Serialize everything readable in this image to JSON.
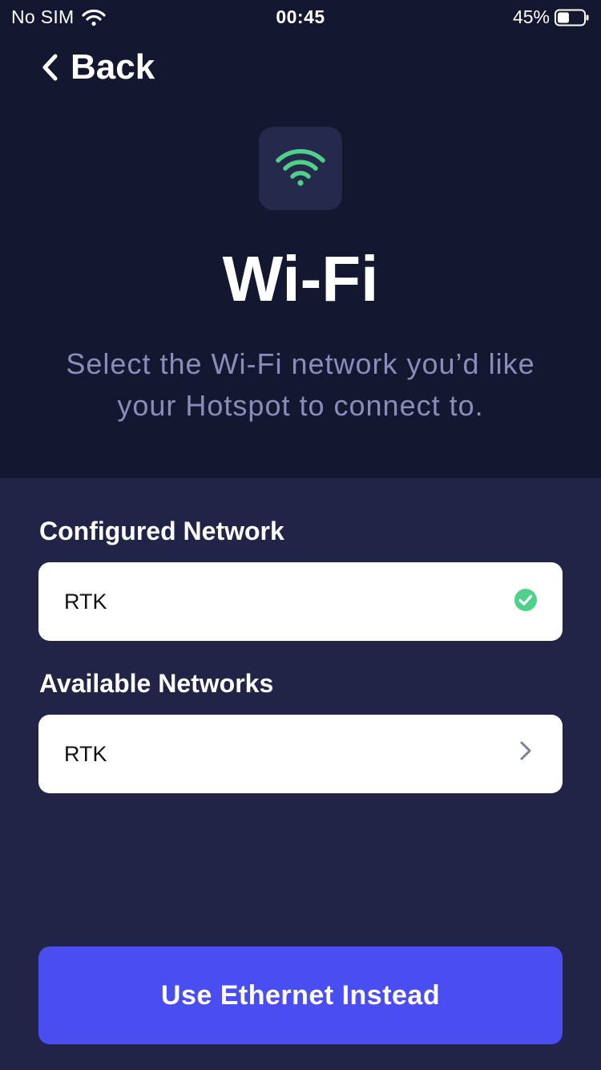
{
  "status_bar": {
    "carrier": "No SIM",
    "time": "00:45",
    "battery_percent": "45%",
    "battery_level": 0.45,
    "icons": [
      "wifi-signal-icon",
      "battery-icon"
    ]
  },
  "nav": {
    "back_label": "Back",
    "back_icon": "chevron-left-icon"
  },
  "header": {
    "icon": "wifi-icon",
    "icon_color": "#4fd18b",
    "title": "Wi-Fi",
    "subtitle": "Select the Wi-Fi network you’d like your Hotspot to connect to."
  },
  "configured": {
    "heading": "Configured Network",
    "network": {
      "name": "RTK",
      "icon": "check-circle-icon",
      "icon_color": "#4fd18b"
    }
  },
  "available": {
    "heading": "Available Networks",
    "networks": [
      {
        "name": "RTK",
        "icon": "chevron-right-icon"
      }
    ]
  },
  "actions": {
    "ethernet_label": "Use Ethernet Instead",
    "accent_color": "#4a4ef0"
  },
  "colors": {
    "header_bg": "#141730",
    "body_bg": "#222447",
    "subtitle_text": "#8a8db8"
  }
}
